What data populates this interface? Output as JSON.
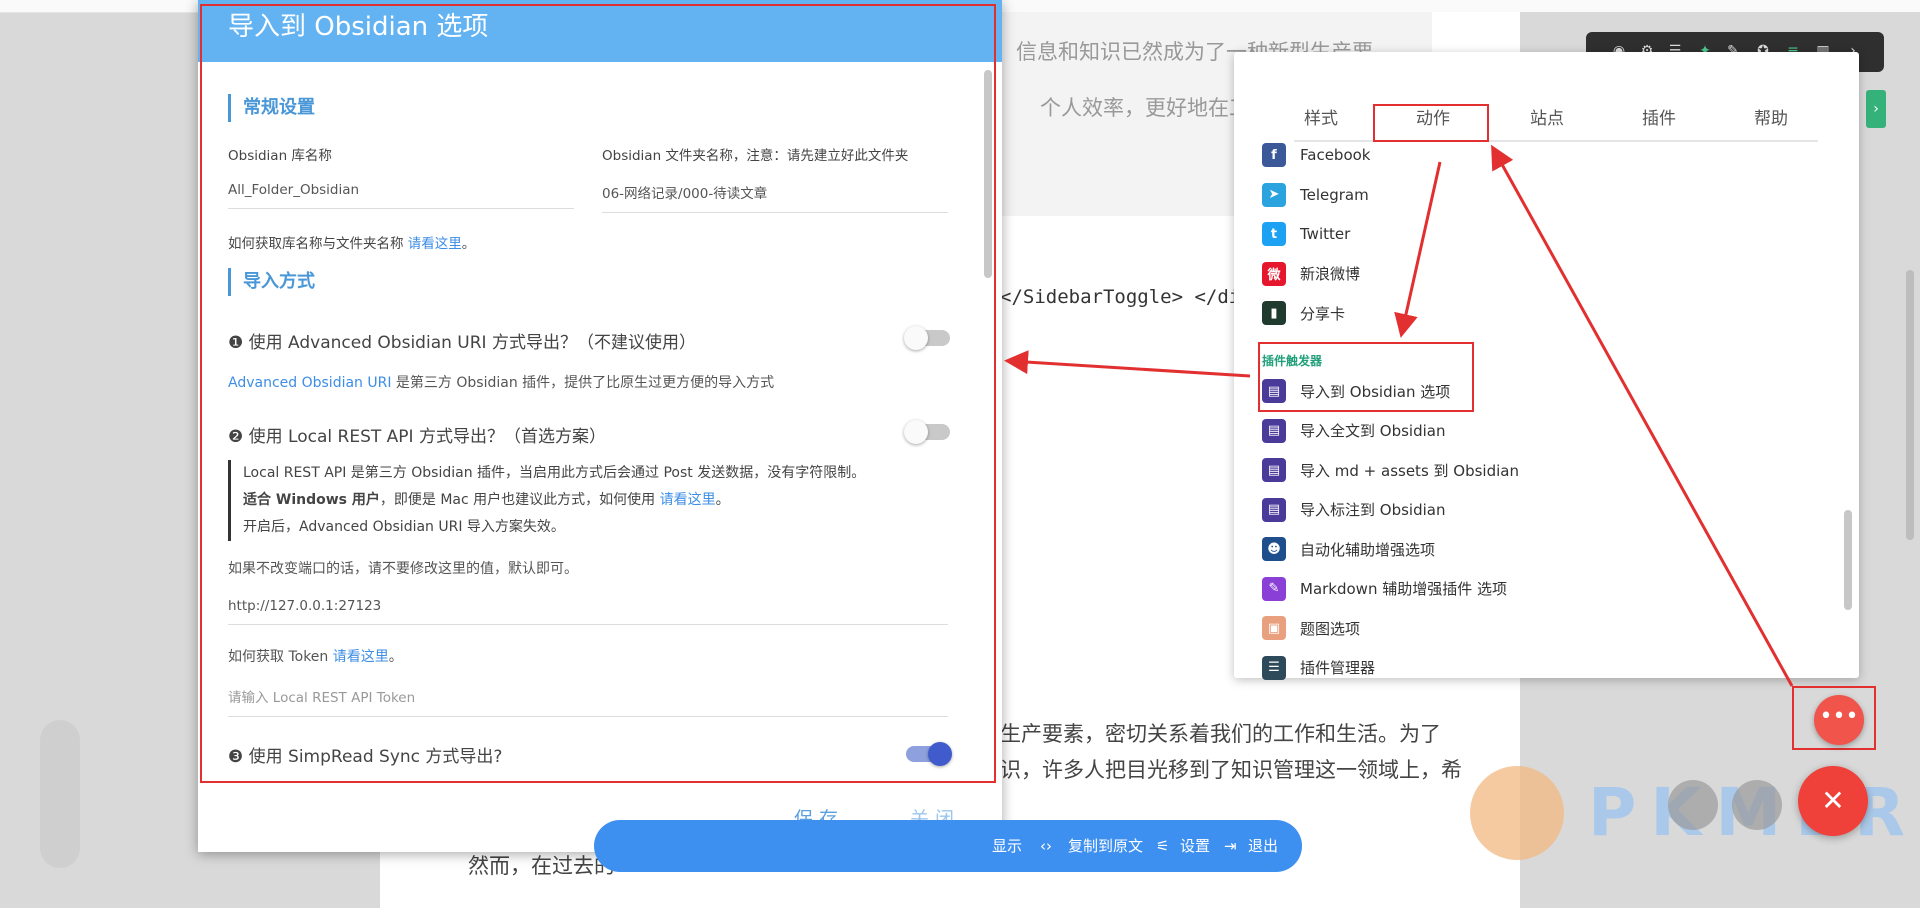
{
  "article": {
    "lines": [
      "信息和知识已然成为了一种新型生产要",
      "个人效率，更好地在工作",
      "</SidebarToggle> </div",
      "生产要素，密切关系着我们的工作和生活。为了",
      "识，许多人把目光移到了知识管理这一领域上，希",
      "然而，在过去的"
    ]
  },
  "dialog": {
    "title": "导入到 Obsidian 选项",
    "general": {
      "heading": "常规设置",
      "vault_label": "Obsidian 库名称",
      "vault_value": "All_Folder_Obsidian",
      "folder_label": "Obsidian 文件夹名称，注意：请先建立好此文件夹",
      "folder_value": "06-网络记录/000-待读文章",
      "help_text": "如何获取库名称与文件夹名称",
      "help_link": "请看这里",
      "help_end": "。"
    },
    "import": {
      "heading": "导入方式",
      "opt1_label": "❶ 使用 Advanced Obsidian URI 方式导出？（不建议使用）",
      "opt1_desc_link": "Advanced Obsidian URI",
      "opt1_desc": " 是第三方 Obsidian 插件，提供了比原生过更方便的导入方式",
      "opt2_label": "❷ 使用 Local REST API 方式导出？（首选方案）",
      "quote_line1": "Local REST API 是第三方 Obsidian 插件，当启用此方式后会通过 Post 发送数据，没有字符限制。",
      "quote_line2_bold": "适合 Windows 用户",
      "quote_line2": "，即便是 Mac 用户也建议此方式，如何使用 ",
      "quote_line2_link": "请看这里",
      "quote_line2_end": "。",
      "quote_line3": "开启后，Advanced Obsidian URI 导入方案失效。",
      "port_note": "如果不改变端口的话，请不要修改这里的值，默认即可。",
      "port_value": "http://127.0.0.1:27123",
      "token_help": "如何获取 Token ",
      "token_link": "请看这里",
      "token_end": "。",
      "token_placeholder": "请输入 Local REST API Token",
      "opt3_label": "❸ 使用 SimpRead Sync 方式导出?"
    },
    "toggles": {
      "opt1": false,
      "opt2": false,
      "opt3": true
    },
    "footer": {
      "save": "保存",
      "close": "关闭"
    }
  },
  "bottom_bar": {
    "show": "显示",
    "copy": "复制到原文",
    "settings": "设置",
    "exit": "退出"
  },
  "popup": {
    "tabs": [
      "样式",
      "动作",
      "站点",
      "插件",
      "帮助"
    ],
    "items": [
      {
        "label": "Facebook",
        "icon": "facebook-icon",
        "color": "#3b5998",
        "glyph": "f"
      },
      {
        "label": "Telegram",
        "icon": "telegram-icon",
        "color": "#2aa3df",
        "glyph": "➤"
      },
      {
        "label": "Twitter",
        "icon": "twitter-icon",
        "color": "#1da1f2",
        "glyph": "t"
      },
      {
        "label": "新浪微博",
        "icon": "weibo-icon",
        "color": "#e6162d",
        "glyph": "微"
      },
      {
        "label": "分享卡",
        "icon": "share-card-icon",
        "color": "#1f3a2f",
        "glyph": "▮"
      }
    ],
    "group_label": "插件触发器",
    "plugin_items": [
      {
        "label": "导入到 Obsidian 选项",
        "icon": "obsidian-doc-icon",
        "color": "#4a3a9a",
        "glyph": "▤"
      },
      {
        "label": "导入全文到 Obsidian",
        "icon": "obsidian-doc-icon",
        "color": "#4a3a9a",
        "glyph": "▤"
      },
      {
        "label": "导入 md + assets 到 Obsidian",
        "icon": "obsidian-doc-icon",
        "color": "#4a3a9a",
        "glyph": "▤"
      },
      {
        "label": "导入标注到 Obsidian",
        "icon": "obsidian-doc-icon",
        "color": "#4a3a9a",
        "glyph": "▤"
      },
      {
        "label": "自动化辅助增强选项",
        "icon": "robot-icon",
        "color": "#1f4e8c",
        "glyph": "☻"
      },
      {
        "label": "Markdown 辅助增强插件 选项",
        "icon": "markdown-icon",
        "color": "#8a3fd6",
        "glyph": "✎"
      },
      {
        "label": "题图选项",
        "icon": "image-icon",
        "color": "#e8a07e",
        "glyph": "▣"
      },
      {
        "label": "插件管理器",
        "icon": "list-icon",
        "color": "#2c4a5a",
        "glyph": "☰"
      }
    ]
  },
  "fab": {
    "more": "•••",
    "close": "✕"
  },
  "watermark": "PKMER"
}
